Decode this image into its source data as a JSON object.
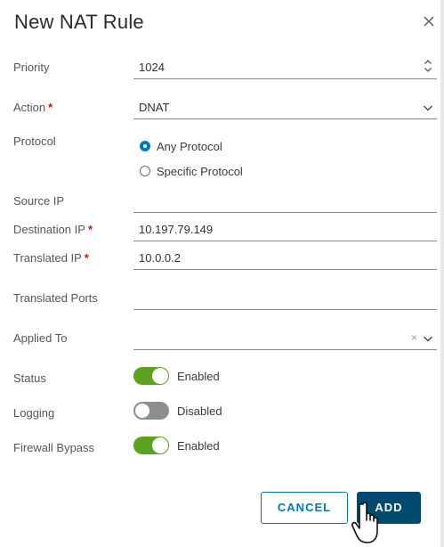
{
  "dialog": {
    "title": "New NAT Rule",
    "close_icon": "close-icon"
  },
  "form": {
    "priority": {
      "label": "Priority",
      "value": "1024"
    },
    "action": {
      "label": "Action",
      "required": "*",
      "value": "DNAT"
    },
    "protocol": {
      "label": "Protocol",
      "options": [
        "Any Protocol",
        "Specific Protocol"
      ],
      "selected": "Any Protocol"
    },
    "source_ip": {
      "label": "Source IP",
      "value": ""
    },
    "destination_ip": {
      "label": "Destination IP",
      "required": "*",
      "value": "10.197.79.149"
    },
    "translated_ip": {
      "label": "Translated IP",
      "required": "*",
      "value": "10.0.0.2"
    },
    "translated_ports": {
      "label": "Translated Ports",
      "value": ""
    },
    "applied_to": {
      "label": "Applied To",
      "value": "",
      "clear_glyph": "×"
    },
    "status": {
      "label": "Status",
      "state": "Enabled",
      "on": true
    },
    "logging": {
      "label": "Logging",
      "state": "Disabled",
      "on": false
    },
    "firewall_bypass": {
      "label": "Firewall Bypass",
      "state": "Enabled",
      "on": true
    }
  },
  "footer": {
    "cancel_label": "CANCEL",
    "add_label": "ADD"
  },
  "colors": {
    "primary": "#0079b8",
    "primary_dark": "#004a70",
    "toggle_on": "#5aa220",
    "toggle_off": "#8d8d8d",
    "required": "#c21d00"
  }
}
